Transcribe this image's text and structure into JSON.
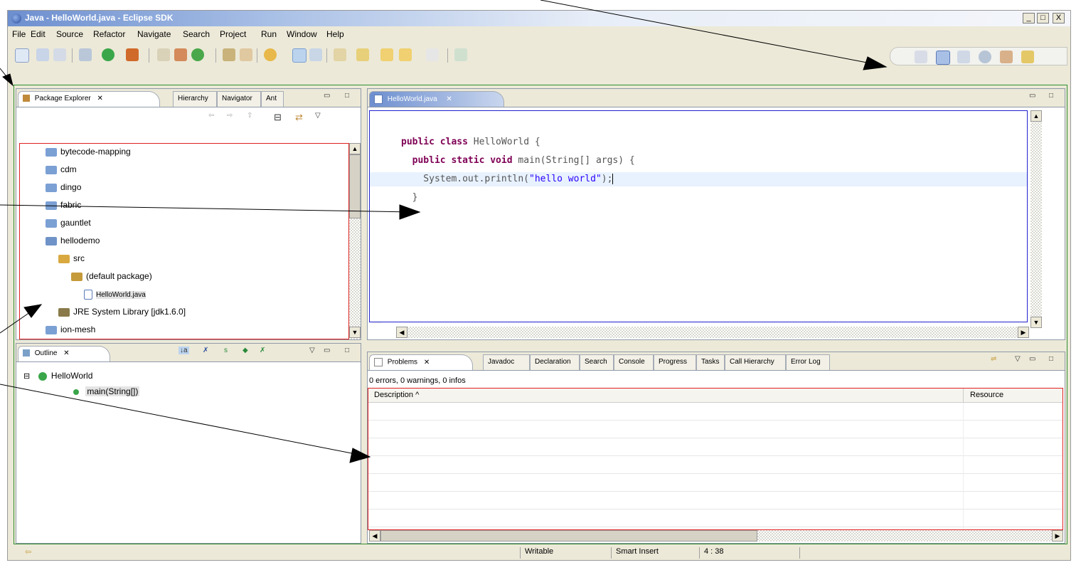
{
  "window": {
    "title": "Java - HelloWorld.java - Eclipse SDK",
    "controls": [
      "_",
      "□",
      "X"
    ]
  },
  "menu": [
    "File",
    "Edit",
    "Source",
    "Refactor",
    "Navigate",
    "Search",
    "Project",
    "Run",
    "Window",
    "Help"
  ],
  "package_explorer": {
    "tabs": [
      "Package Explorer",
      "Hierarchy",
      "Navigator",
      "Ant"
    ],
    "tree": [
      {
        "label": "bytecode-mapping",
        "icon": "folder-icon",
        "depth": 0
      },
      {
        "label": "cdm",
        "icon": "folder-icon",
        "depth": 0
      },
      {
        "label": "dingo",
        "icon": "folder-icon",
        "depth": 0
      },
      {
        "label": "fabric",
        "icon": "folder-icon",
        "depth": 0
      },
      {
        "label": "gauntlet",
        "icon": "folder-icon",
        "depth": 0
      },
      {
        "label": "hellodemo",
        "icon": "project-icon",
        "depth": 0
      },
      {
        "label": "src",
        "icon": "source-folder-icon",
        "depth": 1
      },
      {
        "label": "(default package)",
        "icon": "package-icon",
        "depth": 2
      },
      {
        "label": "HelloWorld.java",
        "icon": "java-file-icon",
        "depth": 3
      },
      {
        "label": "JRE System Library [jdk1.6.0]",
        "icon": "library-icon",
        "depth": 1
      },
      {
        "label": "ion-mesh",
        "icon": "folder-icon",
        "depth": 0
      }
    ]
  },
  "outline": {
    "tab": "Outline",
    "items": [
      {
        "label": "HelloWorld",
        "icon": "class-icon"
      },
      {
        "label": "main(String[])",
        "icon": "method-icon"
      }
    ]
  },
  "editor": {
    "tab": "HelloWorld.java",
    "lines": [
      {
        "kw": "public class ",
        "rest": "HelloWorld {"
      },
      {
        "kw": "  public static void ",
        "rest": "main(String[] args) {"
      },
      {
        "kw": "",
        "rest": "    System.out.println(",
        "str": "\"hello world\"",
        "tail": ");"
      },
      {
        "kw": "",
        "rest": "  }"
      }
    ]
  },
  "problems": {
    "tabs": [
      "Problems",
      "Javadoc",
      "Declaration",
      "Search",
      "Console",
      "Progress",
      "Tasks",
      "Call Hierarchy",
      "Error Log"
    ],
    "summary": "0 errors, 0 warnings, 0 infos",
    "columns": [
      "Description",
      "Resource"
    ],
    "sort_indicator": "^"
  },
  "status": {
    "writable": "Writable",
    "insert_mode": "Smart Insert",
    "position": "4 : 38"
  },
  "colors": {
    "highlight_red": "#e02020",
    "highlight_blue": "#2020d0",
    "workbench_green": "#2f8f2f"
  }
}
